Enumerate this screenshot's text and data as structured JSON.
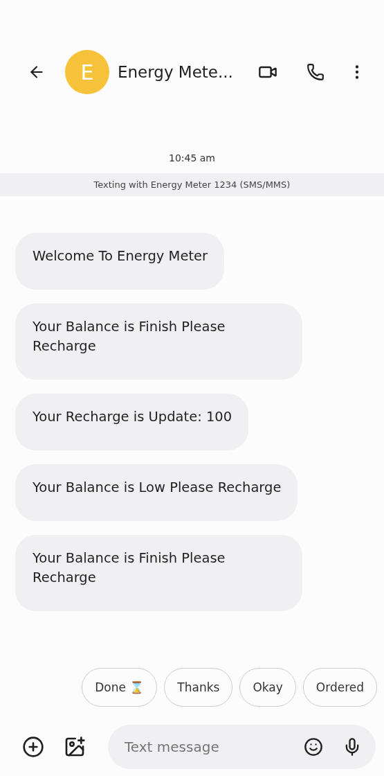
{
  "header": {
    "avatar_letter": "E",
    "title": "Energy Mete..."
  },
  "timestamp": "10:45 am",
  "banner": "Texting with Energy Meter 1234 (SMS/MMS)",
  "messages": [
    {
      "text": "Welcome To Energy Meter"
    },
    {
      "text": "Your Balance is Finish Please Recharge"
    },
    {
      "text": "Your Recharge is Update: 100"
    },
    {
      "text": "Your Balance is Low Please Recharge"
    },
    {
      "text": "Your Balance is Finish Please Recharge"
    }
  ],
  "suggestions": [
    "Done ⌛",
    "Thanks",
    "Okay",
    "Ordered"
  ],
  "composer": {
    "placeholder": "Text message"
  }
}
